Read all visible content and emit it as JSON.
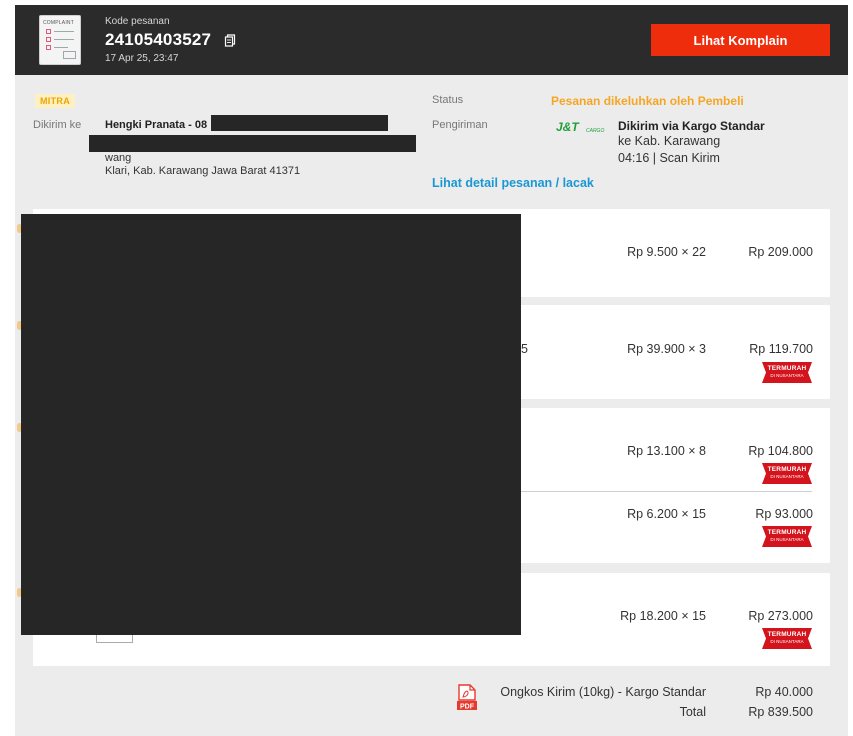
{
  "header": {
    "doc_icon_label": "COMPLAINT",
    "order_code_label": "Kode pesanan",
    "order_number": "24105403527",
    "order_date": "17 Apr 25, 23:47",
    "complaint_button": "Lihat Komplain",
    "button_color": "#ee2d0d"
  },
  "info": {
    "badge": "MITRA",
    "sent_to_label": "Dikirim ke",
    "recipient_name": "Hengki Pranata - 08",
    "address_line1": "wang",
    "address_line2": "Klari, Kab. Karawang Jawa Barat 41371",
    "status_label": "Status",
    "status_value": "Pesanan dikeluhkan oleh Pembeli",
    "status_color": "#f5a623",
    "shipping_label": "Pengiriman",
    "courier_logo_text": "J&T",
    "courier_logo_sub": "CARGO",
    "shipping_method": "Dikirim via Kargo Standar",
    "shipping_destination": "ke Kab. Karawang",
    "shipping_scan": "04:16 | Scan Kirim",
    "detail_link": "Lihat detail pesanan / lacak",
    "link_color": "#1a97d4"
  },
  "items": [
    {
      "qty": "Rp 9.500 × 22",
      "subtotal": "Rp 209.000",
      "badge": false
    },
    {
      "qty": "Rp 39.900 × 3",
      "subtotal": "Rp 119.700",
      "badge": true
    },
    {
      "qty": "Rp 13.100 × 8",
      "subtotal": "Rp 104.800",
      "badge": true
    },
    {
      "qty": "Rp 6.200 × 15",
      "subtotal": "Rp 93.000",
      "badge": true
    },
    {
      "qty": "Rp 18.200 × 15",
      "subtotal": "Rp 273.000",
      "badge": true
    }
  ],
  "item_stubs": [
    "5"
  ],
  "promo_badge": {
    "line1": "TERMURAH",
    "line2": "DI NUSANTARA",
    "color": "#d4141c"
  },
  "footer": {
    "pdf_icon_text": "PDF",
    "shipping_fee_label": "Ongkos Kirim (10kg) - Kargo Standar",
    "shipping_fee_value": "Rp 40.000",
    "total_label": "Total",
    "total_value": "Rp 839.500"
  }
}
